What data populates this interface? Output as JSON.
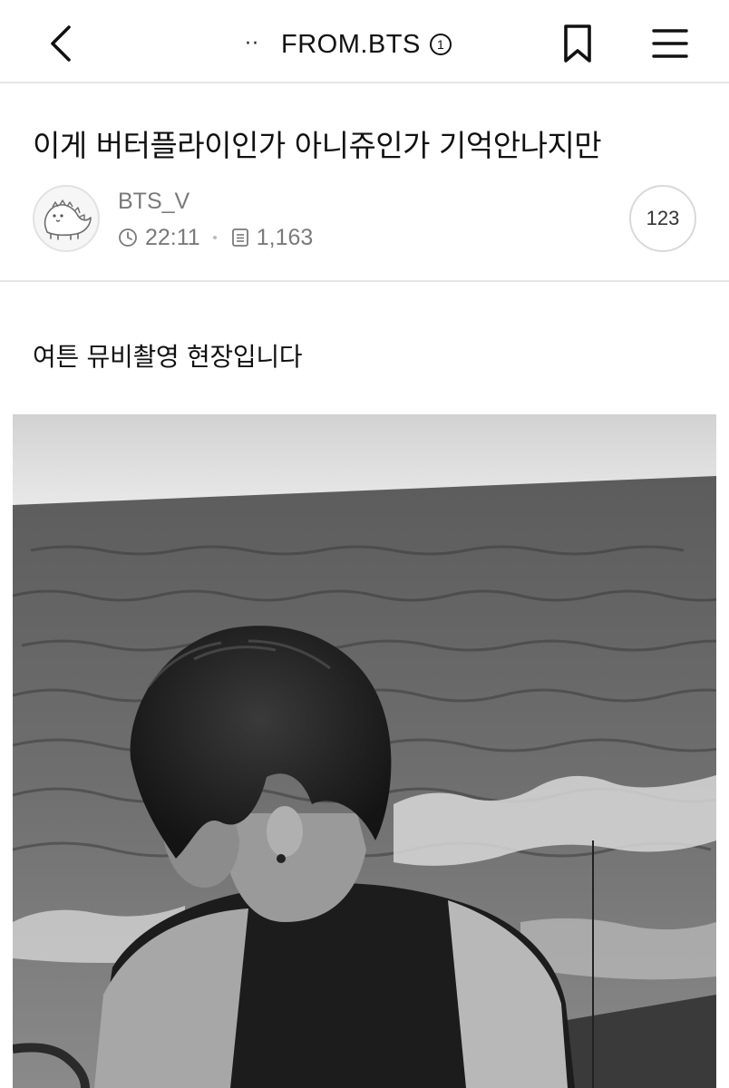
{
  "nav": {
    "back_icon": "chevron-left-icon",
    "dots": "··",
    "board_title": "FROM.BTS",
    "badge": "1",
    "bookmark_icon": "bookmark-icon",
    "menu_icon": "hamburger-menu-icon"
  },
  "post": {
    "title": "이게 버터플라이인가 아니쥬인가 기억안나지만",
    "author": "BTS_V",
    "time": "22:11",
    "views": "1,163",
    "comment_count": "123",
    "body_text": "여튼 뮤비촬영 현장입니다",
    "photo_icon": "photo-image"
  },
  "colors": {
    "text": "#111111",
    "meta": "#7a7a7a",
    "divider": "#e6e6e6"
  }
}
